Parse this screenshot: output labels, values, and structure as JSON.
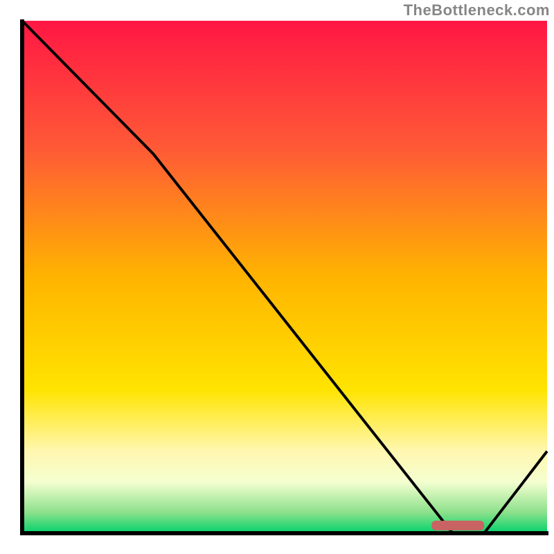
{
  "watermark": "TheBottleneck.com",
  "chart_data": {
    "type": "line",
    "title": "",
    "xlabel": "",
    "ylabel": "",
    "xlim": [
      0,
      100
    ],
    "ylim": [
      0,
      100
    ],
    "x": [
      0,
      25,
      82,
      88,
      100
    ],
    "values": [
      100,
      74,
      0,
      0,
      16
    ],
    "marker": {
      "x_start": 78,
      "x_end": 88,
      "y": 1.5
    },
    "gradient_stops": [
      {
        "offset": 0,
        "color": "#ff1744"
      },
      {
        "offset": 25,
        "color": "#ff5a36"
      },
      {
        "offset": 50,
        "color": "#ffb400"
      },
      {
        "offset": 72,
        "color": "#ffe400"
      },
      {
        "offset": 84,
        "color": "#fff7b0"
      },
      {
        "offset": 90,
        "color": "#f4ffd0"
      },
      {
        "offset": 96,
        "color": "#8be08b"
      },
      {
        "offset": 100,
        "color": "#00d26a"
      }
    ]
  }
}
